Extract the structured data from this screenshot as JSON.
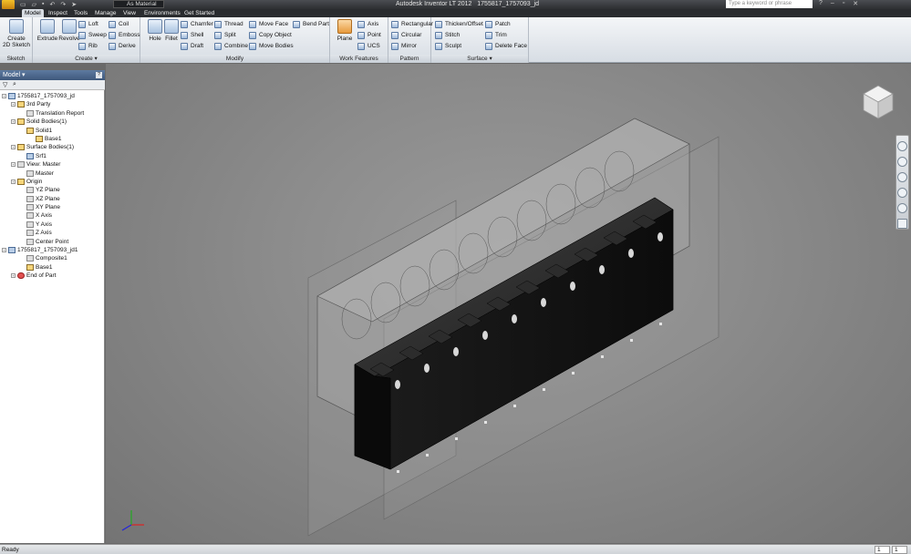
{
  "titlebar": {
    "app_title": "Autodesk Inventor LT 2012",
    "document_name": "1755817_1757093_jd",
    "material_value": "As Material",
    "search_placeholder": "Type a keyword or phrase"
  },
  "tabs": [
    "Model",
    "Inspect",
    "Tools",
    "Manage",
    "View",
    "Environments",
    "Get Started"
  ],
  "ribbon": {
    "sketch": {
      "title": "Sketch",
      "button": "Create\n2D Sketch"
    },
    "create": {
      "title": "Create",
      "big": [
        "Extrude",
        "Revolve"
      ],
      "col1": [
        "Loft",
        "Sweep",
        "Rib"
      ],
      "col2": [
        "Coil",
        "Emboss",
        "Derive"
      ]
    },
    "modify": {
      "title": "Modify",
      "big": [
        "Hole",
        "Fillet"
      ],
      "col1": [
        "Chamfer",
        "Shell",
        "Draft"
      ],
      "col2": [
        "Thread",
        "Split",
        "Combine"
      ],
      "col3": [
        "Move Face",
        "Copy Object",
        "Move Bodies"
      ],
      "col4": [
        "Bend Part"
      ]
    },
    "work_features": {
      "title": "Work Features",
      "big": "Plane",
      "col1": [
        "Axis",
        "Point",
        "UCS"
      ]
    },
    "pattern": {
      "title": "Pattern",
      "col1": [
        "Rectangular",
        "Circular",
        "Mirror"
      ]
    },
    "surface": {
      "title": "Surface",
      "col1": [
        "Thicken/Offset",
        "Stitch",
        "Sculpt"
      ],
      "col2": [
        "Patch",
        "Trim",
        "Delete Face"
      ]
    }
  },
  "browser": {
    "title": "Model",
    "help": "?",
    "tree": [
      {
        "label": "1755817_1757093_jd",
        "depth": 0,
        "icon": "part-icon"
      },
      {
        "label": "3rd Party",
        "depth": 1,
        "icon": "folder-icon"
      },
      {
        "label": "Translation Report",
        "depth": 2,
        "icon": "report-icon"
      },
      {
        "label": "Solid Bodies(1)",
        "depth": 1,
        "icon": "folder-icon"
      },
      {
        "label": "Solid1",
        "depth": 2,
        "icon": "body-icon"
      },
      {
        "label": "Base1",
        "depth": 3,
        "icon": "feature-icon"
      },
      {
        "label": "Surface Bodies(1)",
        "depth": 1,
        "icon": "folder-icon"
      },
      {
        "label": "Srf1",
        "depth": 2,
        "icon": "surface-icon"
      },
      {
        "label": "View: Master",
        "depth": 1,
        "icon": "view-icon"
      },
      {
        "label": "Master",
        "depth": 2,
        "icon": "lock-icon"
      },
      {
        "label": "Origin",
        "depth": 1,
        "icon": "folder-icon"
      },
      {
        "label": "YZ Plane",
        "depth": 2,
        "icon": "plane-icon"
      },
      {
        "label": "XZ Plane",
        "depth": 2,
        "icon": "plane-icon"
      },
      {
        "label": "XY Plane",
        "depth": 2,
        "icon": "plane-icon"
      },
      {
        "label": "X Axis",
        "depth": 2,
        "icon": "axis-icon"
      },
      {
        "label": "Y Axis",
        "depth": 2,
        "icon": "axis-icon"
      },
      {
        "label": "Z Axis",
        "depth": 2,
        "icon": "axis-icon"
      },
      {
        "label": "Center Point",
        "depth": 2,
        "icon": "point-icon"
      },
      {
        "label": "1755817_1757093_jd1",
        "depth": 0,
        "icon": "part-icon"
      },
      {
        "label": "Composite1",
        "depth": 2,
        "icon": "composite-icon"
      },
      {
        "label": "Base1",
        "depth": 2,
        "icon": "feature-icon"
      },
      {
        "label": "End of Part",
        "depth": 1,
        "icon": "end-of-part-icon"
      }
    ]
  },
  "statusbar": {
    "text": "Ready",
    "count1": "1",
    "count2": "1"
  },
  "colors": {
    "accent": "#3f587c",
    "titlebar": "#2c2e31",
    "ribbon": "#e4e8ed",
    "viewport": "#8c8c8c"
  }
}
